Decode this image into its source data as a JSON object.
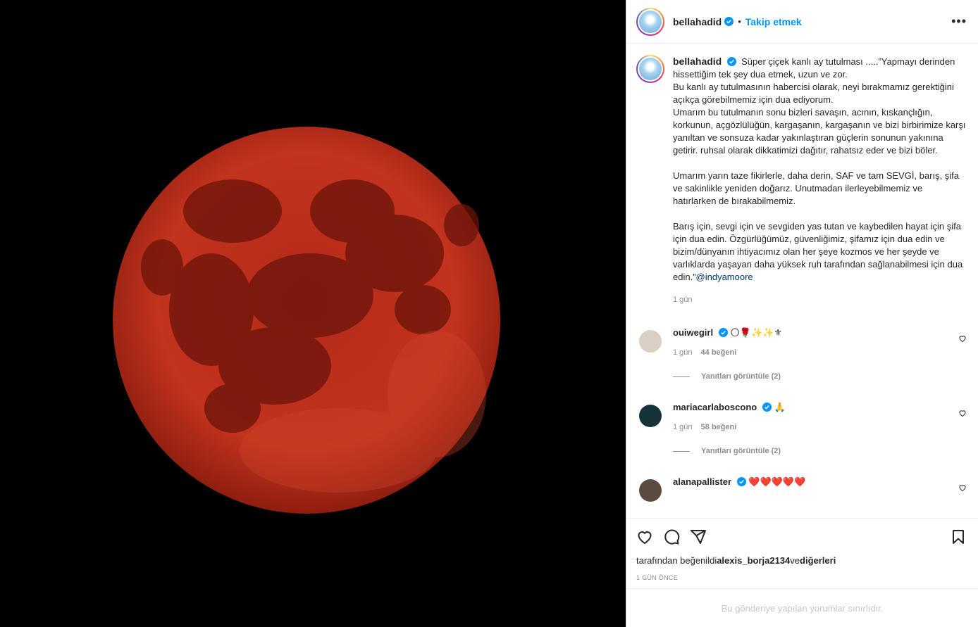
{
  "post": {
    "username": "bellahadid",
    "follow_label": "Takip etmek",
    "dot": "•",
    "more_label": "•••",
    "caption": {
      "username": "bellahadid",
      "text": " Süper çiçek kanlı ay tutulması .....”Yapmayı derinden hissettiğim tek şey dua etmek, uzun ve zor.\nBu kanlı ay tutulmasının habercisi olarak, neyi bırakmamız gerektiğini açıkça görebilmemiz için dua ediyorum.\nUmarım bu tutulmanın sonu bizleri savaşın, acının, kıskançlığın, korkunun, açgözlülüğün, kargaşanın, kargaşanın ve bizi birbirimize karşı yanıltan ve sonsuza kadar yakınlaştıran güçlerin sonunun yakınına getirir. ruhsal olarak dikkatimizi dağıtır, rahatsız eder ve bizi böler.\n\nUmarım yarın taze fikirlerle, daha derin, SAF ve tam SEVGİ, barış, şifa ve sakinlikle yeniden doğarız. Unutmadan ilerleyebilmemiz ve hatırlarken de bırakabilmemiz.\n\nBarış için, sevgi için ve sevgiden yas tutan ve kaybedilen hayat için şifa için dua edin. Özgürlüğümüz, güvenliğimiz, şifamız için dua edin ve bizim/dünyanın ihtiyacımız olan her şeye kozmos ve her şeyde ve varlıklarda yaşayan daha yüksek ruh tarafından sağlanabilmesi için dua edin.”",
      "mention": "@indyamoore",
      "time": "1 gün"
    },
    "comments": [
      {
        "username": "ouiwegirl",
        "text": "🌕🌹✨✨⚜",
        "time": "1 gün",
        "likes": "44 beğeni",
        "replies": "Yanıtları görüntüle (2)",
        "avatar_color": "#d9cfc4"
      },
      {
        "username": "mariacarlaboscono",
        "text": "🙏",
        "time": "1 gün",
        "likes": "58 beğeni",
        "replies": "Yanıtları görüntüle (2)",
        "avatar_color": "#14343a"
      },
      {
        "username": "alanapallister",
        "text": "❤️❤️❤️❤️❤️",
        "avatar_color": "#5a4a40"
      }
    ],
    "liked_by_prefix": "tarafından beğenildi",
    "liked_by_user": "alexis_borja2134",
    "liked_by_mid": "ve",
    "liked_by_suffix": "diğerleri",
    "ago": "1 GÜN ÖNCE",
    "comments_limited": "Bu gönderiye yapılan yorumlar sınırlıdır."
  },
  "colors": {
    "accent": "#0095f6",
    "verified": "#0095f6",
    "moon": "#c0301c",
    "muted": "#8e8e8e"
  },
  "icons": [
    "verified-icon",
    "more-icon",
    "heart-icon",
    "comment-icon",
    "share-icon",
    "bookmark-icon"
  ]
}
